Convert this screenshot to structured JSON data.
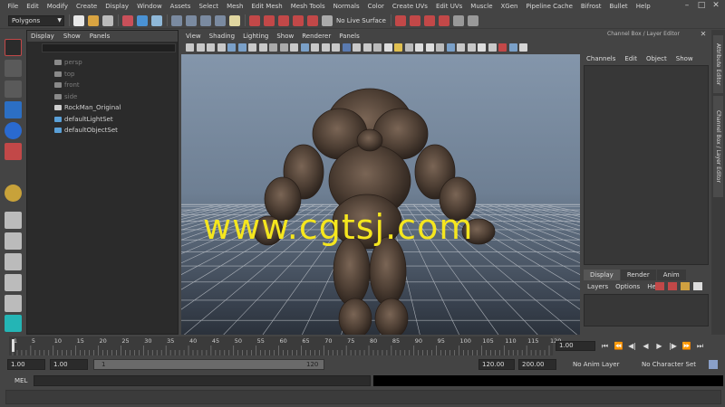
{
  "menu": [
    "File",
    "Edit",
    "Modify",
    "Create",
    "Display",
    "Window",
    "Assets",
    "Select",
    "Mesh",
    "Edit Mesh",
    "Mesh Tools",
    "Normals",
    "Color",
    "Create UVs",
    "Edit UVs",
    "Muscle",
    "XGen",
    "Pipeline Cache",
    "Bifrost",
    "Bullet",
    "Help"
  ],
  "window_controls": {
    "minimize": "–",
    "maximize": "□",
    "close": "✕"
  },
  "status_line": {
    "mode": "Polygons",
    "live_surface": "No Live Surface"
  },
  "outliner": {
    "menu": [
      "Display",
      "Show",
      "Panels"
    ],
    "items": [
      {
        "label": "persp",
        "dim": true,
        "icon": "camera-icon"
      },
      {
        "label": "top",
        "dim": true,
        "icon": "camera-icon"
      },
      {
        "label": "front",
        "dim": true,
        "icon": "camera-icon"
      },
      {
        "label": "side",
        "dim": true,
        "icon": "camera-icon"
      },
      {
        "label": "RockMan_Original",
        "dim": false,
        "icon": "transform-icon"
      },
      {
        "label": "defaultLightSet",
        "dim": false,
        "icon": "set-icon"
      },
      {
        "label": "defaultObjectSet",
        "dim": false,
        "icon": "set-icon"
      }
    ]
  },
  "viewport": {
    "menu": [
      "View",
      "Shading",
      "Lighting",
      "Show",
      "Renderer",
      "Panels"
    ],
    "watermark": "www.cgtsj.com"
  },
  "channel_box": {
    "title": "Channel Box / Layer Editor",
    "close": "✕",
    "menu": [
      "Channels",
      "Edit",
      "Object",
      "Show"
    ]
  },
  "layer_editor": {
    "tabs": [
      "Display",
      "Render",
      "Anim"
    ],
    "active_tab": "Display",
    "menu": [
      "Layers",
      "Options",
      "Help"
    ]
  },
  "side_tabs": [
    "Attribute Editor",
    "Channel Box / Layer Editor"
  ],
  "time_slider": {
    "ticks": [
      "1",
      "5",
      "10",
      "15",
      "20",
      "25",
      "30",
      "35",
      "40",
      "45",
      "50",
      "55",
      "60",
      "65",
      "70",
      "75",
      "80",
      "85",
      "90",
      "95",
      "100",
      "105",
      "110",
      "115",
      "120"
    ],
    "current_frame": "1.00",
    "playback": [
      "⏮",
      "⏪",
      "◀︎|",
      "◀",
      "▶",
      "|▶",
      "⏩",
      "⏭"
    ]
  },
  "range_slider": {
    "start": "1.00",
    "playback_start": "1.00",
    "range_start_label": "1",
    "range_end_label": "120",
    "playback_end": "120.00",
    "end": "200.00",
    "anim_layer": "No Anim Layer",
    "character_set": "No Character Set"
  },
  "command_line": {
    "label": "MEL"
  },
  "colors": {
    "panel": "#444444",
    "field": "#2b2b2b",
    "watermark": "#f5e61e",
    "viewport_top": "#8496ab",
    "viewport_bottom": "#1f242b"
  }
}
